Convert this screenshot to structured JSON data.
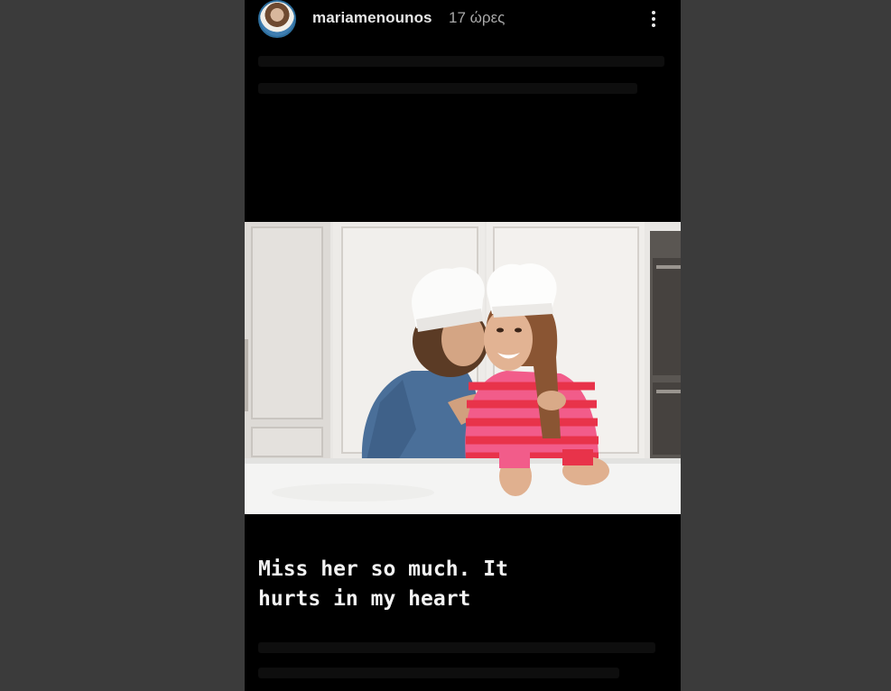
{
  "story": {
    "username": "mariamenounos",
    "time_ago": "17 ώρες",
    "caption": "Miss her so much. It\nhurts in my heart"
  },
  "colors": {
    "page_background": "#3b3b3b",
    "story_background": "#000000",
    "caption_text": "#f2f2f2",
    "striped_sweater_pink": "#f25c8a",
    "striped_sweater_red": "#e8334a",
    "denim_shirt": "#4a6f99"
  },
  "icons": [
    "more-options-icon"
  ]
}
